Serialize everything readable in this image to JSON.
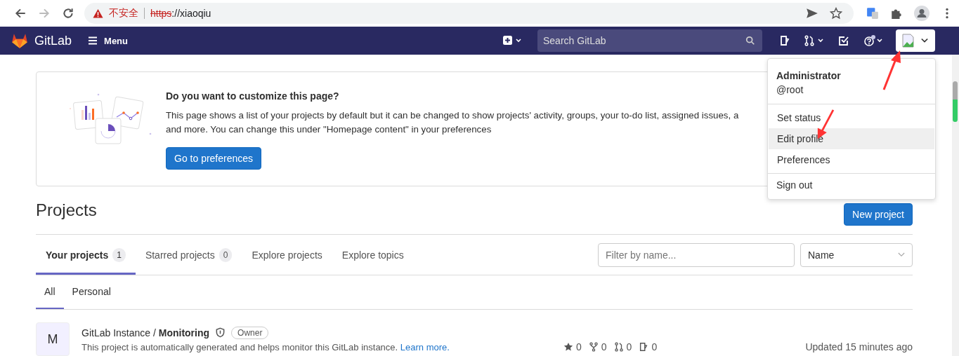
{
  "browser": {
    "security_label": "不安全",
    "url_scheme": "https",
    "url_rest": "://xiaoqiu"
  },
  "navbar": {
    "brand": "GitLab",
    "menu": "Menu",
    "search_placeholder": "Search GitLab"
  },
  "banner": {
    "title": "Do you want to customize this page?",
    "lines": [
      "This page shows a list of your projects by default but it can be changed to show projects' activity, groups, your to-do list, assigned issues, a",
      "and more. You can change this under \"Homepage content\" in your preferences"
    ],
    "button": "Go to preferences"
  },
  "user_menu": {
    "name": "Administrator",
    "username": "@root",
    "items": [
      {
        "label": "Set status",
        "selected": false,
        "divider_before": false
      },
      {
        "label": "Edit profile",
        "selected": true,
        "divider_before": false
      },
      {
        "label": "Preferences",
        "selected": false,
        "divider_before": false
      },
      {
        "label": "Sign out",
        "selected": false,
        "divider_before": true
      }
    ]
  },
  "projects": {
    "title": "Projects",
    "new_button": "New project",
    "tabs": [
      {
        "label": "Your projects",
        "count": "1",
        "selected": true
      },
      {
        "label": "Starred projects",
        "count": "0",
        "selected": false
      },
      {
        "label": "Explore projects",
        "selected": false
      },
      {
        "label": "Explore topics",
        "selected": false
      }
    ],
    "filter_placeholder": "Filter by name...",
    "sort": "Name",
    "subtabs": [
      {
        "label": "All",
        "selected": true
      },
      {
        "label": "Personal",
        "selected": false
      }
    ],
    "rows": [
      {
        "avatar": "M",
        "namespace": "GitLab Instance /",
        "name": "Monitoring",
        "role": "Owner",
        "description": "This project is automatically generated and helps monitor this GitLab instance.",
        "link": "Learn more.",
        "stats": [
          {
            "kind": "star",
            "value": "0"
          },
          {
            "kind": "fork",
            "value": "0"
          },
          {
            "kind": "merge",
            "value": "0"
          },
          {
            "kind": "issue",
            "value": "0"
          }
        ],
        "updated": "Updated 15 minutes ago"
      }
    ]
  }
}
